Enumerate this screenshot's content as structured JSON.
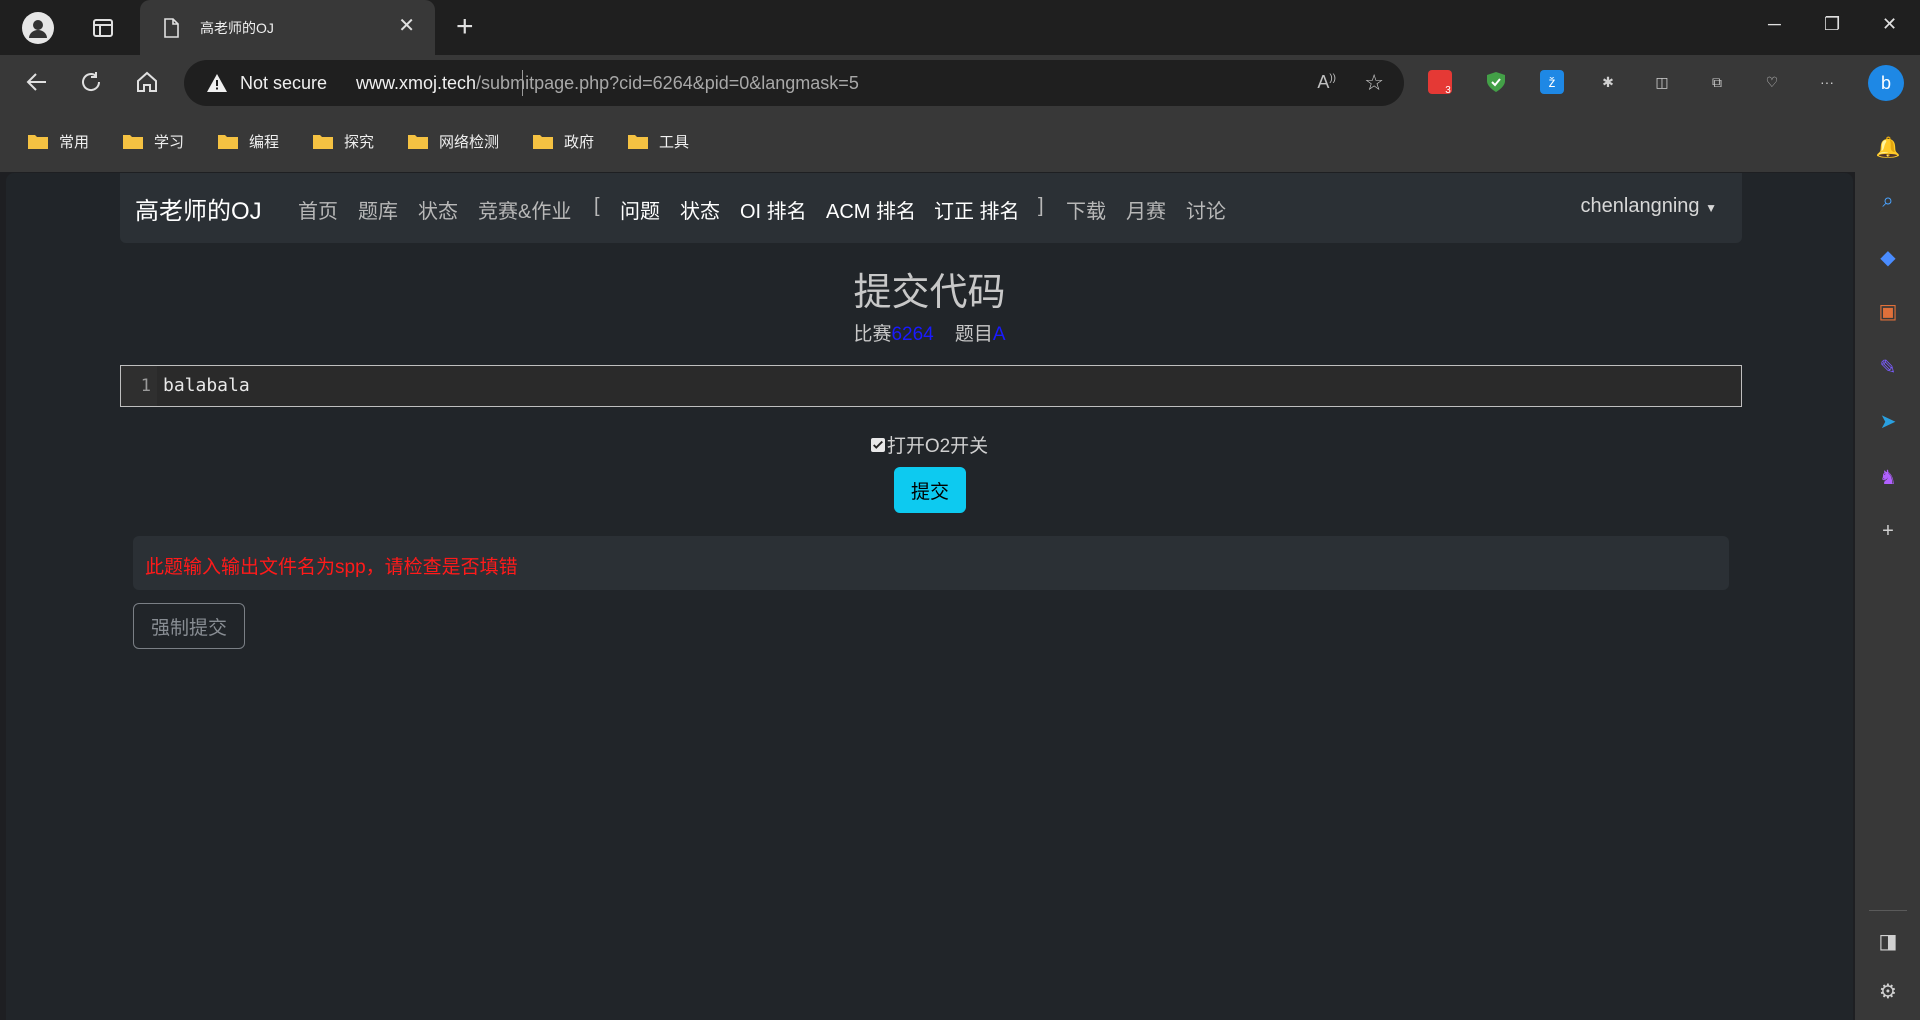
{
  "browser": {
    "tab_title": "高老师的OJ",
    "address": {
      "security_label": "Not secure",
      "host": "www.xmoj.tech",
      "path": "/submitpage.php?cid=6264&pid=0&langmask=5"
    },
    "extensions": [
      {
        "name": "ext-red-badge",
        "badge": "3",
        "color": "#e53935"
      },
      {
        "name": "ext-shield",
        "color": "#43a047"
      },
      {
        "name": "ext-blue-z",
        "color": "#1e88e5"
      }
    ],
    "bookmarks": [
      "常用",
      "学习",
      "编程",
      "探究",
      "网络检测",
      "政府",
      "工具"
    ]
  },
  "site": {
    "brand": "高老师的OJ",
    "nav": {
      "home": "首页",
      "problems": "题库",
      "status": "状态",
      "contest": "竞赛&作业",
      "bracket_open": "[",
      "c_problems": "问题",
      "c_status": "状态",
      "oi_rank": "OI 排名",
      "acm_rank": "ACM 排名",
      "fix_rank": "订正 排名",
      "bracket_close": "]",
      "download": "下载",
      "monthly": "月赛",
      "discuss": "讨论"
    },
    "user": "chenlangning"
  },
  "page": {
    "title": "提交代码",
    "contest_label": "比赛",
    "contest_id": "6264",
    "problem_label": "题目",
    "problem_id": "A",
    "editor": {
      "line_number": "1",
      "code": "balabala"
    },
    "o2_label": "打开O2开关",
    "o2_checked": true,
    "submit_label": "提交",
    "warning": "此题输入输出文件名为spp，请检查是否填错",
    "force_submit_label": "强制提交"
  }
}
